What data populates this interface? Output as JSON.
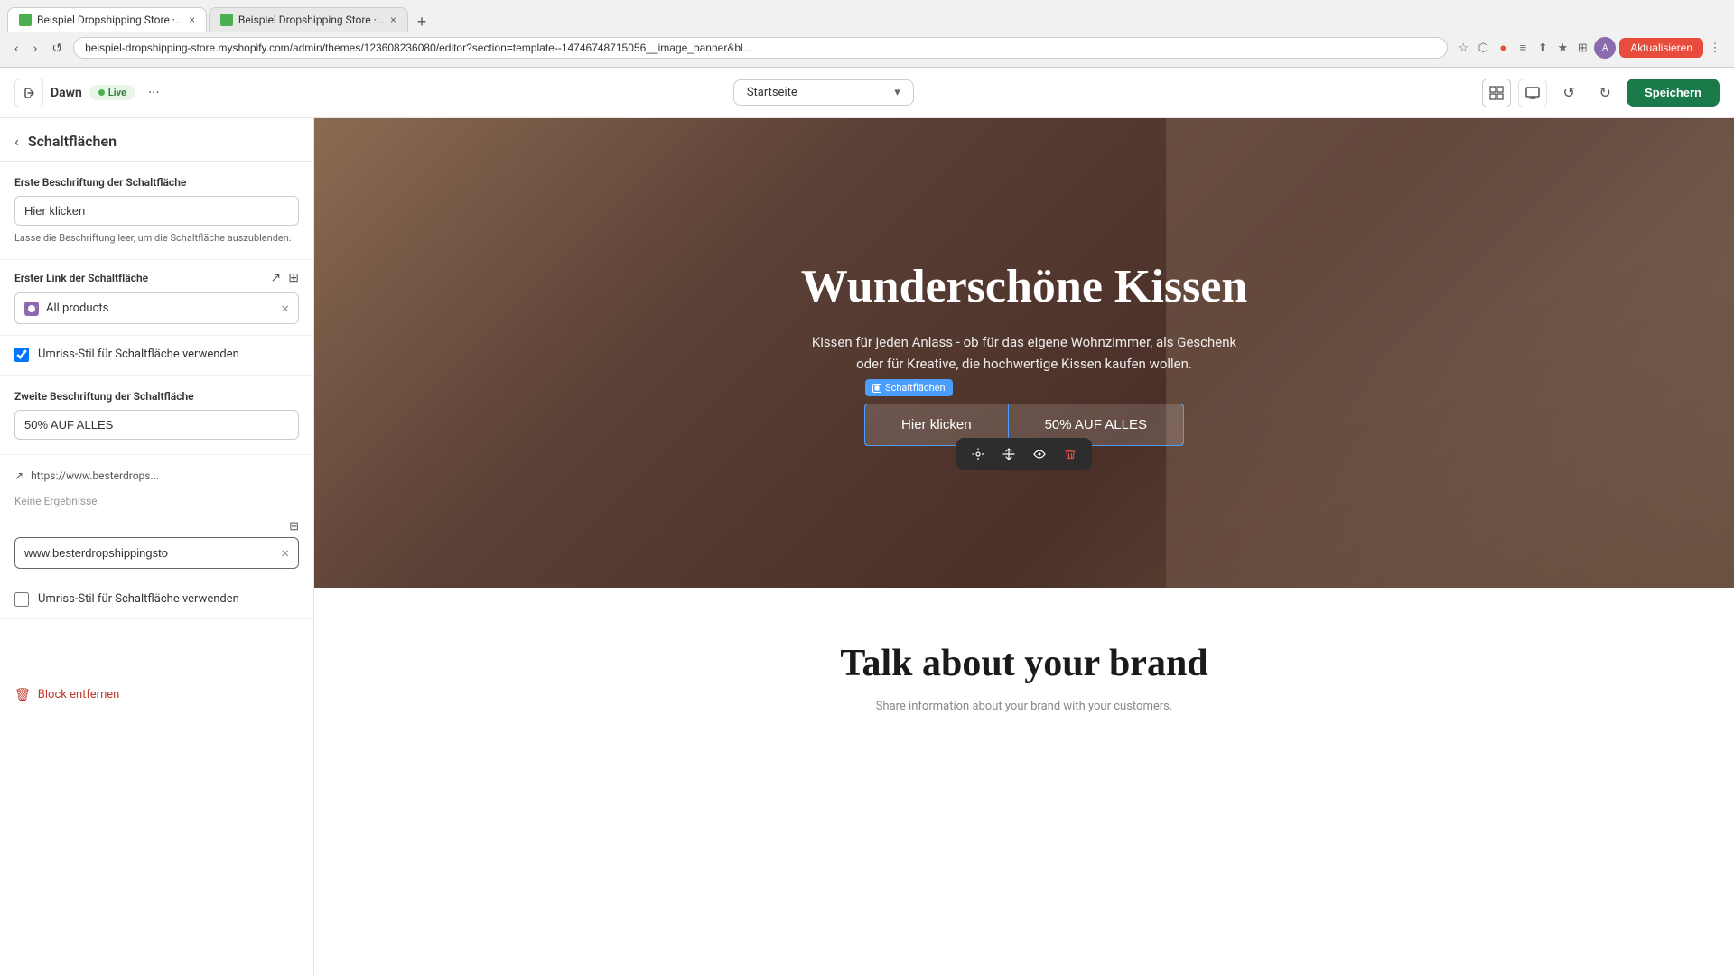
{
  "browser": {
    "tabs": [
      {
        "label": "Beispiel Dropshipping Store ·...",
        "active": true
      },
      {
        "label": "Beispiel Dropshipping Store ·...",
        "active": false
      }
    ],
    "address": "beispiel-dropshipping-store.myshopify.com/admin/themes/123608236080/editor?section=template--14746748715056__image_banner&bl...",
    "aktualisieren": "Aktualisieren"
  },
  "toolbar": {
    "theme_name": "Dawn",
    "live_label": "Live",
    "more_dots": "···",
    "page_select": "Startseite",
    "save_label": "Speichern",
    "undo": "↺",
    "redo": "↻"
  },
  "panel": {
    "title": "Schaltflächen",
    "sections": {
      "first_label_section": {
        "label": "Erste Beschriftung der Schaltfläche",
        "value": "Hier klicken",
        "hint": "Lasse die Beschriftung leer, um die Schaltfläche auszublenden."
      },
      "first_link_section": {
        "label": "Erster Link der Schaltfläche",
        "all_products_text": "All products",
        "clear": "×"
      },
      "first_outline_checkbox": {
        "label": "Umriss-Stil für Schaltfläche verwenden",
        "checked": true
      },
      "second_label_section": {
        "label": "Zweite Beschriftung der Schaltfläche",
        "value": "50% AUF ALLES"
      },
      "second_link_section": {
        "url_display": "https://www.besterdrops...",
        "no_results": "Keine Ergebnisse",
        "url_input_value": "www.besterdropshippingsto"
      },
      "second_outline_checkbox": {
        "label": "Umriss-Stil für Schaltfläche verwenden",
        "checked": false
      }
    },
    "block_remove": "Block entfernen"
  },
  "preview": {
    "hero": {
      "title": "Wunderschöne Kissen",
      "subtitle": "Kissen für jeden Anlass - ob für das eigene Wohnzimmer, als Geschenk oder für Kreative, die hochwertige Kissen kaufen wollen.",
      "btn1_label": "Hier klicken",
      "btn2_label": "50% AUF ALLES",
      "schaltflachen_badge": "Schaltflächen"
    },
    "brand": {
      "title": "Talk about your brand",
      "subtitle": ""
    }
  },
  "icons": {
    "back": "‹",
    "external_link": "↗",
    "database": "⊞",
    "tag": "⬟",
    "close": "×",
    "trash": "🗑",
    "settings": "⚙",
    "eye": "👁",
    "delete": "🗑"
  }
}
